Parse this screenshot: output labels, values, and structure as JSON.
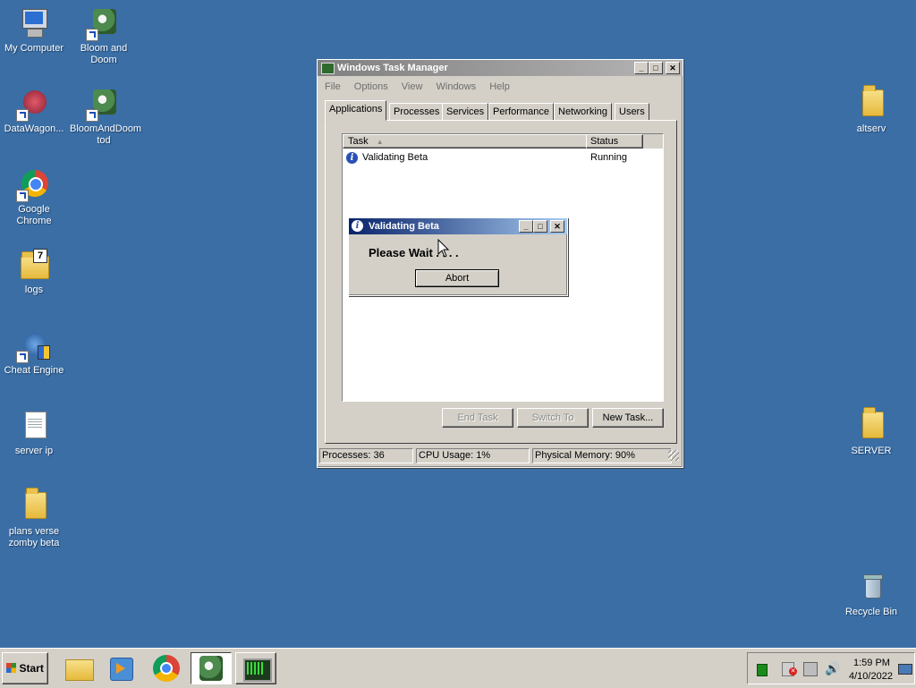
{
  "desktop": {
    "icons_left": [
      {
        "label": "My Computer",
        "icon": "my-computer-icon"
      },
      {
        "label": "DataWagon...",
        "icon": "datawagon-icon"
      },
      {
        "label": "Google Chrome",
        "icon": "chrome-icon"
      },
      {
        "label": "logs",
        "icon": "folder-icon"
      },
      {
        "label": "Cheat Engine",
        "icon": "cheat-engine-icon"
      },
      {
        "label": "server ip",
        "icon": "text-file-icon"
      },
      {
        "label": "plans verse zomby beta",
        "icon": "folder-icon"
      }
    ],
    "icons_col2": [
      {
        "label": "Bloom and Doom",
        "icon": "bloom-and-doom-icon"
      },
      {
        "label": "BloomAndDoom tod",
        "icon": "bloom-and-doom-icon"
      }
    ],
    "icons_right": [
      {
        "label": "altserv",
        "icon": "folder-icon"
      },
      {
        "label": "SERVER",
        "icon": "folder-icon"
      },
      {
        "label": "Recycle Bin",
        "icon": "recycle-bin-icon"
      }
    ]
  },
  "task_manager": {
    "title": "Windows Task Manager",
    "menu": [
      "File",
      "Options",
      "View",
      "Windows",
      "Help"
    ],
    "tabs": [
      "Applications",
      "Processes",
      "Services",
      "Performance",
      "Networking",
      "Users"
    ],
    "selected_tab": "Applications",
    "columns": {
      "task": "Task",
      "status": "Status"
    },
    "rows": [
      {
        "task": "Validating Beta",
        "status": "Running"
      }
    ],
    "buttons": {
      "end_task": "End Task",
      "switch_to": "Switch To",
      "new_task": "New Task..."
    },
    "status_bar": {
      "processes": "Processes: 36",
      "cpu": "CPU Usage: 1%",
      "memory": "Physical Memory: 90%"
    }
  },
  "dialog": {
    "title": "Validating Beta",
    "message": "Please Wait . . . .",
    "abort_label": "Abort"
  },
  "taskbar": {
    "start_label": "Start",
    "time": "1:59 PM",
    "date": "4/10/2022"
  },
  "colors": {
    "desktop": "#3a6ea5",
    "title_active": "#0a246a",
    "title_inactive": "#808080"
  }
}
